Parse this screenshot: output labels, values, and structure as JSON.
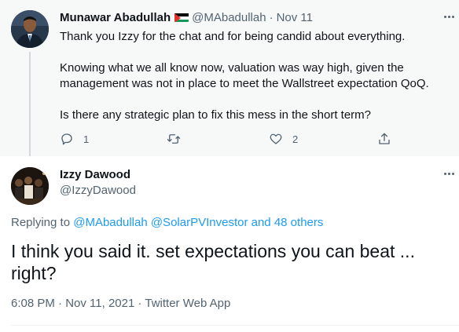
{
  "parent_tweet": {
    "author_name": "Munawar Abadullah",
    "author_flag_icon": "palestine-flag-icon",
    "handle": "@MAbadullah",
    "separator": "·",
    "date": "Nov 11",
    "body": [
      "Thank you Izzy for the chat and for being candid about everything.",
      "Knowing what we all know now, valuation was way high, given the",
      "management was not in place to meet the Wallstreet expectation QoQ.",
      "Is there any strategic plan to fix this mess in the short term?"
    ],
    "actions": {
      "reply_count": "1",
      "retweet_count": "",
      "like_count": "2"
    }
  },
  "main_tweet": {
    "author_name": "Izzy Dawood",
    "handle": "@IzzyDawood",
    "replying_to_prefix": "Replying to ",
    "replying_to_handles": "@MAbadullah @SolarPVInvestor",
    "replying_to_and": " and ",
    "replying_to_others": "48 others",
    "text_line1": "I think you said it.  set expectations you can beat ...",
    "text_line2": "right?",
    "timestamp": "6:08 PM · Nov 11, 2021 · Twitter Web App"
  },
  "colors": {
    "link": "#1d9bf0",
    "secondary_text": "#536471",
    "primary_text": "#0f1419",
    "parent_background": "#f7f9f9"
  }
}
